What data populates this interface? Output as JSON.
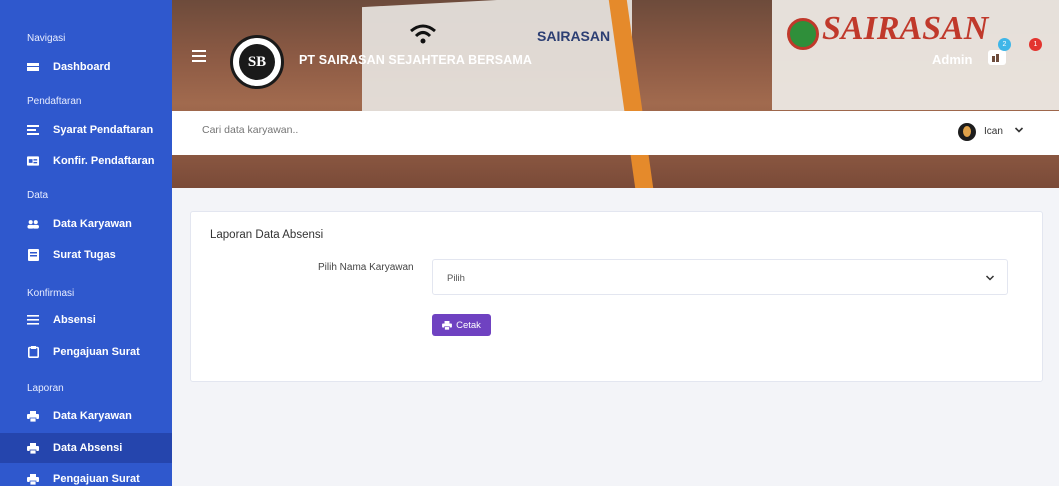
{
  "sidebar": {
    "sections": [
      {
        "heading": "Navigasi",
        "items": [
          {
            "label": "Dashboard",
            "icon": "dashboard-icon"
          }
        ]
      },
      {
        "heading": "Pendaftaran",
        "items": [
          {
            "label": "Syarat Pendaftaran",
            "icon": "list-icon"
          },
          {
            "label": "Konfir. Pendaftaran",
            "icon": "id-card-icon"
          }
        ]
      },
      {
        "heading": "Data",
        "items": [
          {
            "label": "Data Karyawan",
            "icon": "users-icon"
          },
          {
            "label": "Surat Tugas",
            "icon": "document-icon"
          }
        ]
      },
      {
        "heading": "Konfirmasi",
        "items": [
          {
            "label": "Absensi",
            "icon": "list-lines-icon"
          },
          {
            "label": "Pengajuan Surat",
            "icon": "clipboard-icon"
          }
        ]
      },
      {
        "heading": "Laporan",
        "items": [
          {
            "label": "Data Karyawan",
            "icon": "print-icon"
          },
          {
            "label": "Data Absensi",
            "icon": "print-icon",
            "active": true
          },
          {
            "label": "Pengajuan Surat",
            "icon": "print-icon"
          }
        ]
      }
    ]
  },
  "header": {
    "company": "PT SAIRASAN SEJAHTERA BERSAMA",
    "logo_text": "SB",
    "admin_label": "Admin",
    "cart_badge": "2",
    "alert_badge": "1",
    "sign_left_text": "SAIRASAN",
    "sign_right_text": "SAIRASAN"
  },
  "search": {
    "placeholder": "Cari data karyawan..",
    "user_name": "Ican"
  },
  "card": {
    "title": "Laporan Data Absensi",
    "field_label": "Pilih Nama Karyawan",
    "select_value": "Pilih",
    "button_label": "Cetak"
  },
  "colors": {
    "sidebar": "#2f58cd",
    "sidebar_active": "#2545ad",
    "button": "#6f42c1",
    "badge_info": "#3fb6e8",
    "badge_danger": "#e3342f"
  }
}
